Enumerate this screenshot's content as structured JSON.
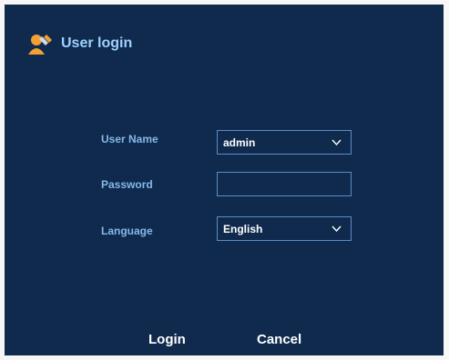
{
  "window": {
    "title": "User login",
    "icon": "user-login-icon"
  },
  "form": {
    "username_label": "User Name",
    "username_value": "admin",
    "password_label": "Password",
    "password_value": "",
    "language_label": "Language",
    "language_value": "English"
  },
  "buttons": {
    "login": "Login",
    "cancel": "Cancel"
  },
  "colors": {
    "background": "#0f2a4d",
    "title_text": "#9fd0ff",
    "label_text": "#86b8ea",
    "field_border": "#5b8cc7",
    "button_text": "#ffffff",
    "icon_accent": "#f2a033"
  }
}
